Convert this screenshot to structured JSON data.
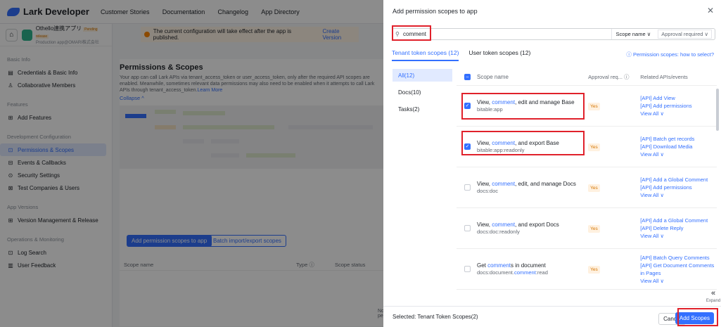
{
  "topbar": {
    "logo": "Lark Developer",
    "nav": [
      "Customer Stories",
      "Documentation",
      "Changelog",
      "App Directory"
    ]
  },
  "app": {
    "name": "Othello連携アプリ",
    "badge": "Pending release",
    "sub": "Production app@OMARI株式会社"
  },
  "notice": {
    "text": "The current configuration will take effect after the app is published.",
    "action": "Create Version"
  },
  "sidebar": {
    "sections": [
      {
        "title": "Basic Info",
        "items": [
          {
            "label": "Credentials & Basic Info",
            "icon": "▤"
          },
          {
            "label": "Collaborative Members",
            "icon": "♙"
          }
        ]
      },
      {
        "title": "Features",
        "items": [
          {
            "label": "Add Features",
            "icon": "⊞"
          }
        ]
      },
      {
        "title": "Development Configuration",
        "items": [
          {
            "label": "Permissions & Scopes",
            "icon": "⊡",
            "active": true
          },
          {
            "label": "Events & Callbacks",
            "icon": "⊟"
          },
          {
            "label": "Security Settings",
            "icon": "⊙"
          },
          {
            "label": "Test Companies & Users",
            "icon": "⊠"
          }
        ]
      },
      {
        "title": "App Versions",
        "items": [
          {
            "label": "Version Management & Release",
            "icon": "⊞"
          }
        ]
      },
      {
        "title": "Operations & Monitoring",
        "items": [
          {
            "label": "Log Search",
            "icon": "⊡"
          },
          {
            "label": "User Feedback",
            "icon": "▥"
          }
        ]
      }
    ]
  },
  "main": {
    "title": "Permissions & Scopes",
    "desc": "Your app can call Lark APIs via tenant_access_token or user_access_token, only after the required API scopes are enabled. Meanwhile, sometimes relevant data permissions may also need to be enabled when it attempts to call Lark APIs through tenant_access_token.",
    "learn": "Learn More",
    "collapse": "Collapse ^",
    "btn_add": "Add permission scopes to app",
    "btn_batch": "Batch import/export scopes",
    "col_scope": "Scope name",
    "col_type": "Type ⓘ",
    "col_status": "Scope status",
    "no_perm": "No pe"
  },
  "dialog": {
    "title": "Add permission scopes to app",
    "search_value": "comment",
    "scope_name": "Scope name ∨",
    "approval": "Approval required ∨",
    "tabs": [
      "Tenant token scopes (12)",
      "User token scopes (12)"
    ],
    "help": "ⓘ Permission scopes: how to select?",
    "cats": [
      "All(12)",
      "Docs(10)",
      "Tasks(2)"
    ],
    "headers": {
      "name": "Scope name",
      "approval": "Approval req... ⓘ",
      "apis": "Related APIs/events"
    },
    "rows": [
      {
        "pre": "View, ",
        "hl": "comment",
        "post": ", edit and manage Base",
        "code": "bitable:app",
        "checked": true,
        "yes": "Yes",
        "apis": [
          "[API] Add View",
          "[API] Add permissions",
          "View All ∨"
        ]
      },
      {
        "pre": "View, ",
        "hl": "comment",
        "post": ", and export Base",
        "code": "bitable:app:readonly",
        "checked": true,
        "yes": "Yes",
        "apis": [
          "[API] Batch get records",
          "[API] Download Media",
          "View All ∨"
        ]
      },
      {
        "pre": "View, ",
        "hl": "comment",
        "post": ", edit, and manage Docs",
        "code": "docs:doc",
        "checked": false,
        "yes": "Yes",
        "apis": [
          "[API] Add a Global Comment",
          "[API] Add permissions",
          "View All ∨"
        ]
      },
      {
        "pre": "View, ",
        "hl": "comment",
        "post": ", and export Docs",
        "code": "docs:doc:readonly",
        "checked": false,
        "yes": "Yes",
        "apis": [
          "[API] Add a Global Comment",
          "[API] Delete Reply",
          "View All ∨"
        ]
      },
      {
        "pre": "Get ",
        "hl": "comment",
        "post": "s in document",
        "code": "docs:document.",
        "codehl": "comment",
        "codepost": ":read",
        "checked": false,
        "yes": "Yes",
        "apis": [
          "[API] Batch Query Comments",
          "[API] Get Document Comments in Pages",
          "View All ∨"
        ]
      }
    ],
    "selected": "Selected: Tenant Token Scopes(2)",
    "cancel": "Cancel",
    "add": "Add Scopes",
    "expand": "Expand"
  }
}
